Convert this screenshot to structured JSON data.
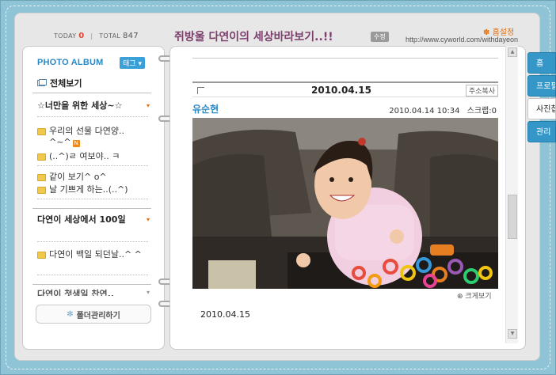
{
  "header": {
    "today_label": "TODAY",
    "today_count": "0",
    "total_label": "TOTAL",
    "total_count": "847",
    "site_title": "쥐방울 다연이의 세상바라보기..!!",
    "edit_badge": "수정",
    "home_setting": "홈설정",
    "home_url": "http://www.cyworld.com/withdayeon"
  },
  "sidebar": {
    "album_title": "PHOTO ALBUM",
    "tag_button": "태그",
    "all_view": "전체보기",
    "folders": [
      {
        "title": "☆너만을 위한 세상~☆",
        "items": [
          "우리의 선물 다연양.. ^~^",
          "(..^)ㄹ 여보야.. ㅋ",
          "같이 보기^ o^",
          "날 기쁘게 하는..(..^)"
        ]
      },
      {
        "title": "다연이 세상에서 100일",
        "items": [
          "다연이 백일 되던날..^ ^"
        ]
      },
      {
        "title": "다연이 첫생일 찬연..",
        "items": []
      }
    ],
    "new_badge": "N",
    "folder_manage": "폴더관리하기"
  },
  "post": {
    "date": "2010.04.15",
    "address_copy": "주소복사",
    "author": "유순현",
    "timestamp": "2010.04.14 10:34",
    "scrap_label": "스크랩:0",
    "zoom_label": "크게보기",
    "caption": "2010.04.15"
  },
  "tabs": [
    {
      "label": "홈",
      "active": false
    },
    {
      "label": "프로필",
      "active": false
    },
    {
      "label": "사진첩",
      "active": true
    },
    {
      "label": "관리",
      "active": false
    }
  ],
  "colors": {
    "frame": "#8fc3d6",
    "accent_blue": "#2a88c5",
    "title_purple": "#7b3f6b",
    "tab_blue": "#3597c7",
    "today_red": "#e0452d"
  },
  "icons": [
    "folder-icon",
    "album-all-icon",
    "settings-gear-icon",
    "zoom-icon",
    "flower-icon"
  ]
}
